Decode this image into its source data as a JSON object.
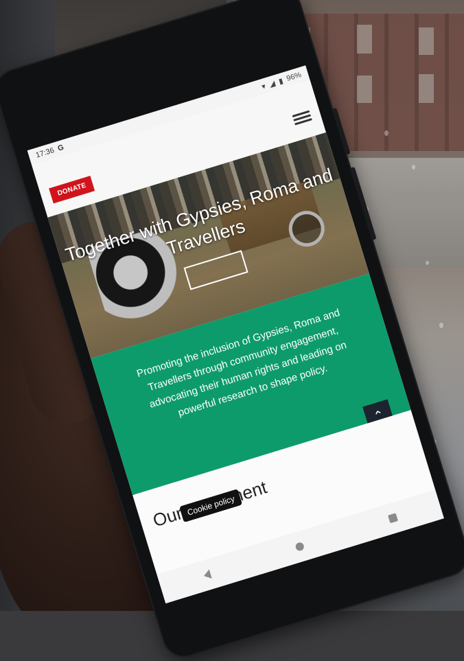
{
  "status_bar": {
    "time": "17:36",
    "google_glyph": "G",
    "battery": "96%"
  },
  "header": {
    "donate_label": "DONATE",
    "menu_icon": "hamburger-menu-icon"
  },
  "hero": {
    "title": "Together with Gypsies, Roma and Travellers"
  },
  "mission": {
    "text": "Promoting the inclusion of Gypsies, Roma and Travellers through community engagement, advocating their human rights and leading on powerful research to shape policy."
  },
  "section": {
    "heading": "Our Movement"
  },
  "cookie": {
    "label": "Cookie policy"
  },
  "colors": {
    "donate": "#d0141c",
    "mission_bg": "#0e9b6b",
    "scroll_top_bg": "#1c2430"
  },
  "icons": {
    "scroll_top": "chevron-up-icon",
    "nav_back": "back-triangle-icon",
    "nav_home": "home-circle-icon",
    "nav_recent": "recent-square-icon"
  }
}
